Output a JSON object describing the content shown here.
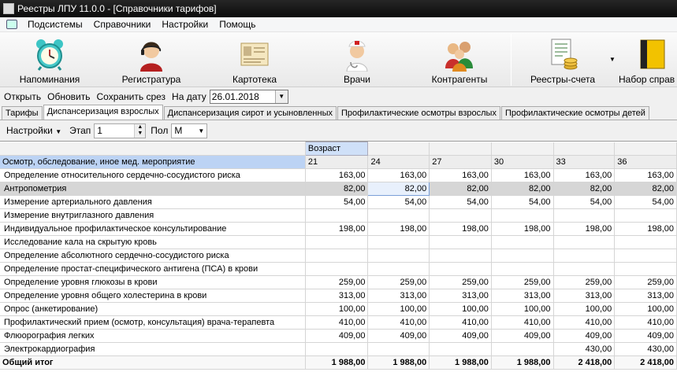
{
  "window": {
    "title": "Реестры ЛПУ 11.0.0 - [Справочники тарифов]"
  },
  "menu": [
    "Подсистемы",
    "Справочники",
    "Настройки",
    "Помощь"
  ],
  "toolbar": [
    {
      "label": "Напоминания",
      "icon": "alarm-clock-icon"
    },
    {
      "label": "Регистратура",
      "icon": "receptionist-icon"
    },
    {
      "label": "Картотека",
      "icon": "card-index-icon"
    },
    {
      "label": "Врачи",
      "icon": "doctor-icon"
    },
    {
      "label": "Контрагенты",
      "icon": "contractors-icon"
    },
    {
      "label": "Реестры-счета",
      "icon": "invoice-registry-icon"
    },
    {
      "label": "Набор справ",
      "icon": "reference-set-icon"
    }
  ],
  "actions": {
    "open": "Открыть",
    "refresh": "Обновить",
    "save_slice": "Сохранить срез",
    "date_label": "На дату",
    "date_value": "26.01.2018"
  },
  "tabs": [
    "Тарифы",
    "Диспансеризация взрослых",
    "Диспансеризация сирот и усыновленных",
    "Профилактические осмотры взрослых",
    "Профилактические осмотры детей"
  ],
  "active_tab": 1,
  "filters": {
    "settings": "Настройки",
    "stage_label": "Этап",
    "stage_value": "1",
    "sex_label": "Пол",
    "sex_value": "М"
  },
  "grid": {
    "age_header": "Возраст",
    "row_header": "Осмотр, обследование, иное мед. мероприятие",
    "ages": [
      "21",
      "24",
      "27",
      "30",
      "33",
      "36"
    ],
    "rows": [
      {
        "name": "Определение относительного сердечно-сосудистого риска",
        "values": [
          "163,00",
          "163,00",
          "163,00",
          "163,00",
          "163,00",
          "163,00"
        ]
      },
      {
        "name": "Антропометрия",
        "values": [
          "82,00",
          "82,00",
          "82,00",
          "82,00",
          "82,00",
          "82,00"
        ]
      },
      {
        "name": "Измерение артериального давления",
        "values": [
          "54,00",
          "54,00",
          "54,00",
          "54,00",
          "54,00",
          "54,00"
        ]
      },
      {
        "name": "Измерение внутриглазного давления",
        "values": [
          "",
          "",
          "",
          "",
          "",
          ""
        ]
      },
      {
        "name": "Индивидуальное профилактическое консультирование",
        "values": [
          "198,00",
          "198,00",
          "198,00",
          "198,00",
          "198,00",
          "198,00"
        ]
      },
      {
        "name": "Исследование кала на скрытую кровь",
        "values": [
          "",
          "",
          "",
          "",
          "",
          ""
        ]
      },
      {
        "name": "Определение абсолютного сердечно-сосудистого риска",
        "values": [
          "",
          "",
          "",
          "",
          "",
          ""
        ]
      },
      {
        "name": "Определение простат-специфического антигена (ПСА) в крови",
        "values": [
          "",
          "",
          "",
          "",
          "",
          ""
        ]
      },
      {
        "name": "Определение уровня глюкозы в крови",
        "values": [
          "259,00",
          "259,00",
          "259,00",
          "259,00",
          "259,00",
          "259,00"
        ]
      },
      {
        "name": "Определение уровня общего холестерина в крови",
        "values": [
          "313,00",
          "313,00",
          "313,00",
          "313,00",
          "313,00",
          "313,00"
        ]
      },
      {
        "name": "Опрос (анкетирование)",
        "values": [
          "100,00",
          "100,00",
          "100,00",
          "100,00",
          "100,00",
          "100,00"
        ]
      },
      {
        "name": "Профилактический прием (осмотр, консультация) врача-терапевта",
        "values": [
          "410,00",
          "410,00",
          "410,00",
          "410,00",
          "410,00",
          "410,00"
        ]
      },
      {
        "name": "Флюорография легких",
        "values": [
          "409,00",
          "409,00",
          "409,00",
          "409,00",
          "409,00",
          "409,00"
        ]
      },
      {
        "name": "Электрокардиография",
        "values": [
          "",
          "",
          "",
          "",
          "430,00",
          "430,00"
        ]
      }
    ],
    "total": {
      "name": "Общий итог",
      "values": [
        "1 988,00",
        "1 988,00",
        "1 988,00",
        "1 988,00",
        "2 418,00",
        "2 418,00"
      ]
    }
  }
}
